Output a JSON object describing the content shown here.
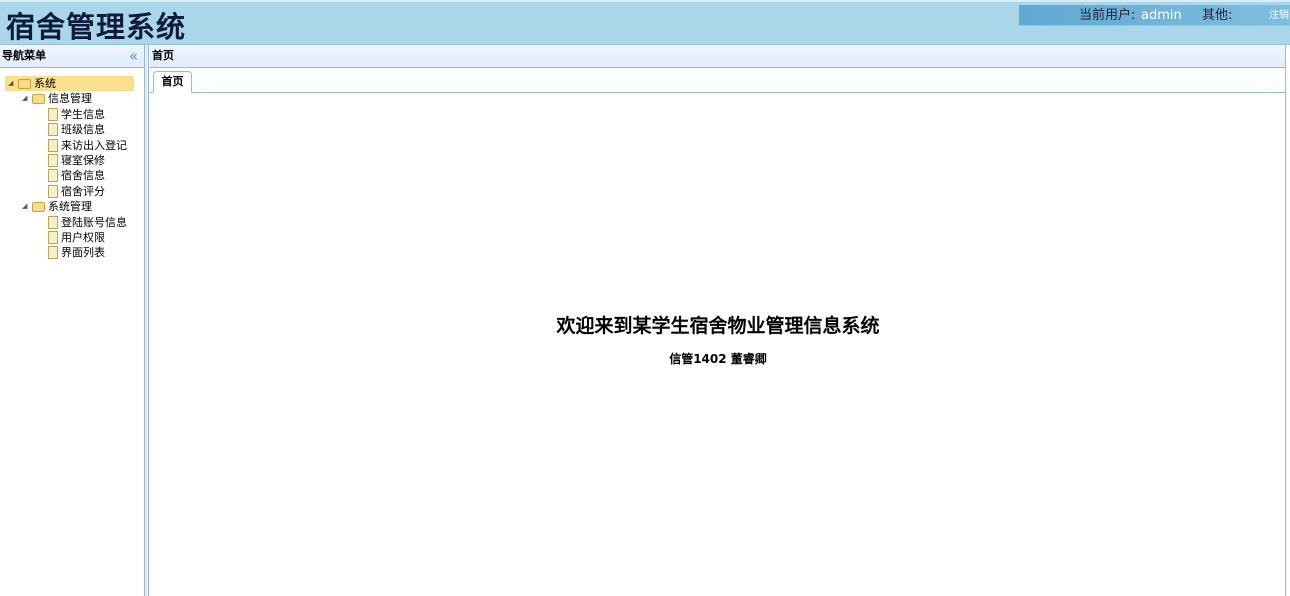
{
  "header": {
    "title": "宿舍管理系统",
    "current_user_label": "当前用户:",
    "username": "admin",
    "other_label": "其他:",
    "logout": "注销"
  },
  "sidebar": {
    "title": "导航菜单",
    "collapse_icon": "double-chevron-left-icon",
    "tree": [
      {
        "label": "系统",
        "level": 0,
        "type": "folder"
      },
      {
        "label": "信息管理",
        "level": 1,
        "type": "folder"
      },
      {
        "label": "学生信息",
        "level": 2,
        "type": "file"
      },
      {
        "label": "班级信息",
        "level": 2,
        "type": "file"
      },
      {
        "label": "来访出入登记",
        "level": 2,
        "type": "file"
      },
      {
        "label": "寝室保修",
        "level": 2,
        "type": "file"
      },
      {
        "label": "宿舍信息",
        "level": 2,
        "type": "file"
      },
      {
        "label": "宿舍评分",
        "level": 2,
        "type": "file"
      },
      {
        "label": "系统管理",
        "level": 1,
        "type": "folder"
      },
      {
        "label": "登陆账号信息",
        "level": 2,
        "type": "file"
      },
      {
        "label": "用户权限",
        "level": 2,
        "type": "file"
      },
      {
        "label": "界面列表",
        "level": 2,
        "type": "file"
      }
    ]
  },
  "main": {
    "panel_title": "首页",
    "tabs": [
      {
        "label": "首页"
      }
    ],
    "welcome": "欢迎来到某学生宿舍物业管理信息系统",
    "subtitle": "信管1402 董睿卿"
  }
}
